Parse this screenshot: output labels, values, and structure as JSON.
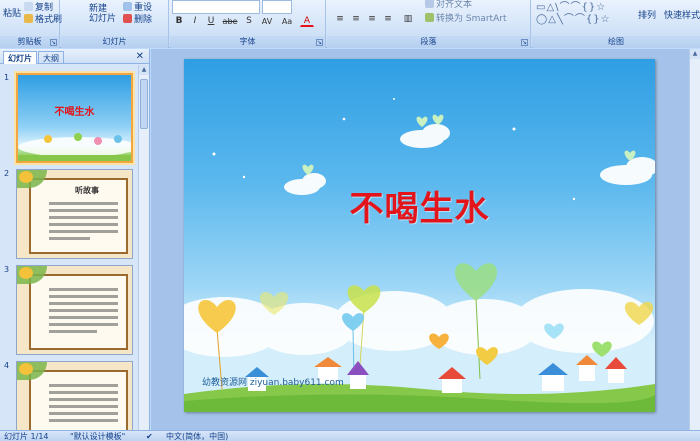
{
  "ribbon": {
    "clipboard": {
      "paste_label": "粘贴",
      "copy_label": "复制",
      "format_painter_label": "格式刷",
      "group_label": "剪贴板"
    },
    "slides": {
      "new_slide_label": "新建\n幻灯片",
      "reset_label": "重设",
      "delete_label": "删除",
      "group_label": "幻灯片"
    },
    "font": {
      "group_label": "字体",
      "bold": "B",
      "italic": "I",
      "underline": "U",
      "strike": "abe",
      "shadow": "S",
      "spacing": "AV",
      "case": "Aa",
      "color": "A"
    },
    "paragraph": {
      "group_label": "段落",
      "align_text_label": "对齐文本",
      "smartart_label": "转换为 SmartArt"
    },
    "drawing": {
      "group_label": "绘图",
      "arrange_label": "排列",
      "quick_styles_label": "快速样式"
    }
  },
  "pane": {
    "tab_slides": "幻灯片",
    "tab_outline": "大纲",
    "close": "✕",
    "thumbs": [
      {
        "num": "1",
        "title": "不喝生水"
      },
      {
        "num": "2",
        "title": "听故事"
      },
      {
        "num": "3",
        "title": ""
      },
      {
        "num": "4",
        "title": ""
      }
    ]
  },
  "slide": {
    "title": "不喝生水",
    "watermark": "幼教资源网 ziyuan.baby611.com"
  },
  "status": {
    "slide_counter": "幻灯片 1/14",
    "theme": "\"默认设计模板\"",
    "language": "中文(简体，中国)"
  },
  "colors": {
    "title_red": "#e4141b",
    "selection_orange": "#f3a640",
    "ribbon_blue": "#15428b"
  }
}
